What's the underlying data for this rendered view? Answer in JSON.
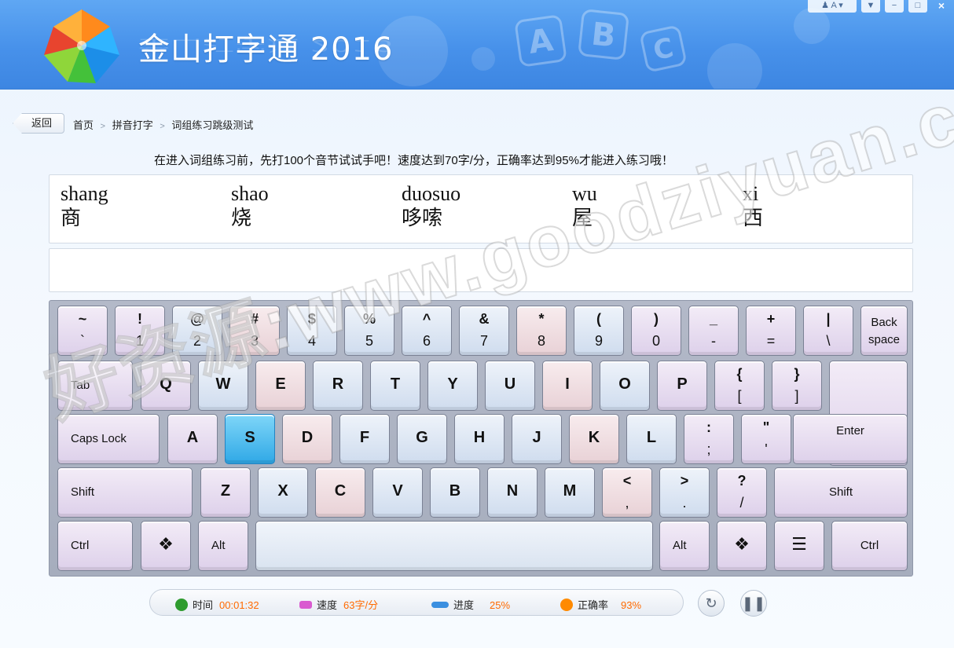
{
  "app": {
    "title": "金山打字通 2016"
  },
  "window_controls": {
    "user": "A",
    "minimize": "−",
    "maximize": "□",
    "close": "×"
  },
  "nav": {
    "back": "返回",
    "breadcrumb": [
      "首页",
      "拼音打字",
      "词组练习跳级测试"
    ],
    "sep": ">"
  },
  "instruction": "在进入词组练习前，先打100个音节试试手吧！速度达到70字/分，正确率达到95%才能进入练习哦！",
  "practice_words": [
    {
      "pinyin": "shang",
      "hanzi": "商"
    },
    {
      "pinyin": "shao",
      "hanzi": "烧"
    },
    {
      "pinyin": "duosuo",
      "hanzi": "哆嗦"
    },
    {
      "pinyin": "wu",
      "hanzi": "屋"
    },
    {
      "pinyin": "xi",
      "hanzi": "西"
    }
  ],
  "keyboard": {
    "number_row": [
      {
        "top": "~",
        "bottom": "`"
      },
      {
        "top": "!",
        "bottom": "1"
      },
      {
        "top": "@",
        "bottom": "2"
      },
      {
        "top": "#",
        "bottom": "3"
      },
      {
        "top": "$",
        "bottom": "4"
      },
      {
        "top": "%",
        "bottom": "5"
      },
      {
        "top": "^",
        "bottom": "6"
      },
      {
        "top": "&",
        "bottom": "7"
      },
      {
        "top": "*",
        "bottom": "8"
      },
      {
        "top": "(",
        "bottom": "9"
      },
      {
        "top": ")",
        "bottom": "0"
      },
      {
        "top": "_",
        "bottom": "-"
      },
      {
        "top": "+",
        "bottom": "="
      },
      {
        "top": "|",
        "bottom": "\\"
      }
    ],
    "backspace_top": "Back",
    "backspace_bottom": "space",
    "tab": "Tab",
    "q_row": [
      "Q",
      "W",
      "E",
      "R",
      "T",
      "Y",
      "U",
      "I",
      "O",
      "P"
    ],
    "bracket_open": {
      "top": "{",
      "bottom": "["
    },
    "bracket_close": {
      "top": "}",
      "bottom": "]"
    },
    "caps": "Caps Lock",
    "a_row": [
      "A",
      "S",
      "D",
      "F",
      "G",
      "H",
      "J",
      "K",
      "L"
    ],
    "semicolon": {
      "top": ":",
      "bottom": ";"
    },
    "quote": {
      "top": "\"",
      "bottom": "'"
    },
    "enter": "Enter",
    "shift": "Shift",
    "z_row": [
      "Z",
      "X",
      "C",
      "V",
      "B",
      "N",
      "M"
    ],
    "comma": {
      "top": "<",
      "bottom": ","
    },
    "period": {
      "top": ">",
      "bottom": "."
    },
    "slash": {
      "top": "?",
      "bottom": "/"
    },
    "ctrl": "Ctrl",
    "alt": "Alt",
    "win_icon": "windows-logo",
    "menu_icon": "context-menu",
    "highlighted_key": "S"
  },
  "status": {
    "time_label": "时间",
    "time_value": "00:01:32",
    "speed_label": "速度",
    "speed_value": "63字/分",
    "progress_label": "进度",
    "progress_value": "25%",
    "accuracy_label": "正确率",
    "accuracy_value": "93%",
    "colors": {
      "time": "#2e9b2e",
      "speed": "#d95bd0",
      "progress": "#3b8fe0",
      "accuracy": "#ff8a00",
      "value": "#ff6a00"
    }
  },
  "watermark": "好资源:www.goodziyuan.com"
}
